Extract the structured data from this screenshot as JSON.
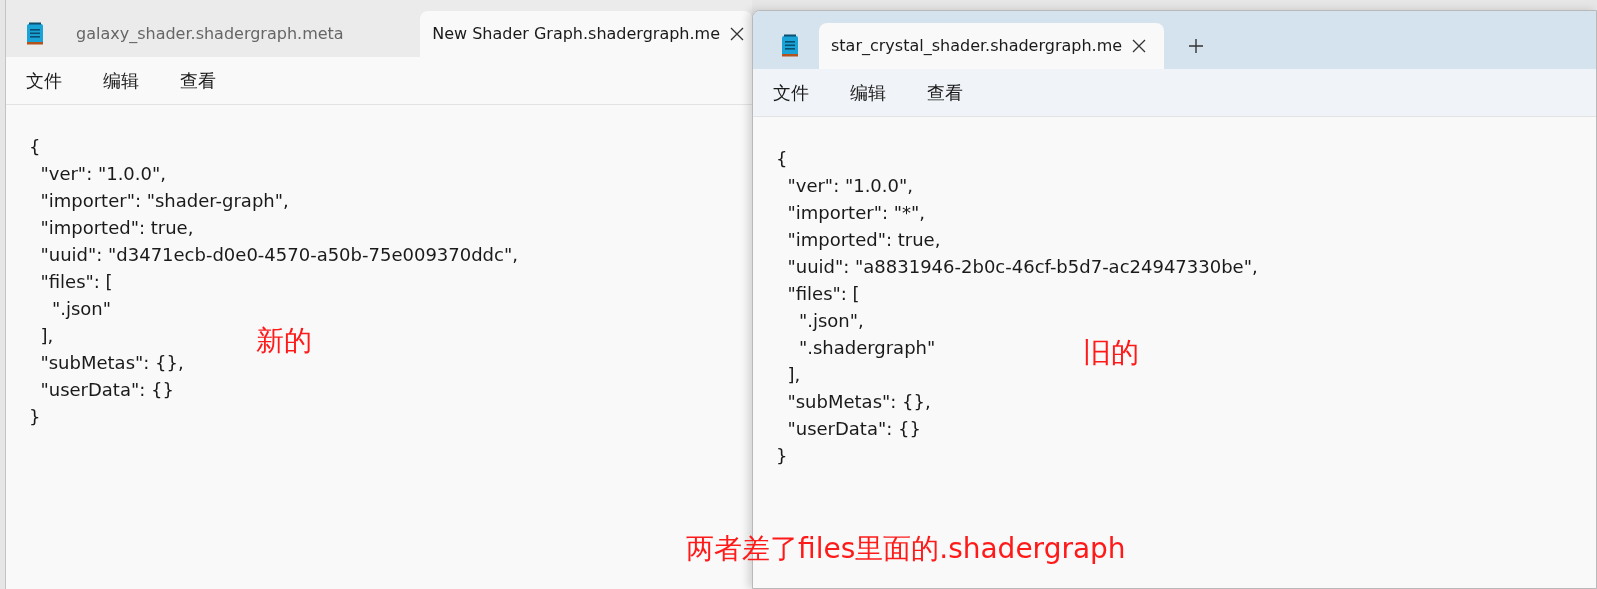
{
  "windows": [
    {
      "active": false,
      "tabs": [
        {
          "title": "galaxy_shader.shadergraph.meta",
          "selected": false,
          "closable": false
        },
        {
          "title": "New Shader Graph.shadergraph.me",
          "selected": true,
          "closable": true
        }
      ],
      "new_tab": false,
      "menu": [
        "文件",
        "编辑",
        "查看"
      ],
      "lines": [
        "{",
        "  \"ver\": \"1.0.0\",",
        "  \"importer\": \"shader-graph\",",
        "  \"imported\": true,",
        "  \"uuid\": \"d3471ecb-d0e0-4570-a50b-75e009370ddc\",",
        "  \"files\": [",
        "    \".json\"",
        "  ],",
        "  \"subMetas\": {},",
        "  \"userData\": {}",
        "}"
      ],
      "note": "新的"
    },
    {
      "active": true,
      "tabs": [
        {
          "title": "star_crystal_shader.shadergraph.me",
          "selected": true,
          "closable": true
        }
      ],
      "new_tab": true,
      "menu": [
        "文件",
        "编辑",
        "查看"
      ],
      "lines": [
        "{",
        "  \"ver\": \"1.0.0\",",
        "  \"importer\": \"*\",",
        "  \"imported\": true,",
        "  \"uuid\": \"a8831946-2b0c-46cf-b5d7-ac24947330be\",",
        "  \"files\": [",
        "    \".json\",",
        "    \".shadergraph\"",
        "  ],",
        "  \"subMetas\": {},",
        "  \"userData\": {}",
        "}"
      ],
      "note": "旧的"
    }
  ],
  "annotation": "两者差了files里面的.shadergraph"
}
